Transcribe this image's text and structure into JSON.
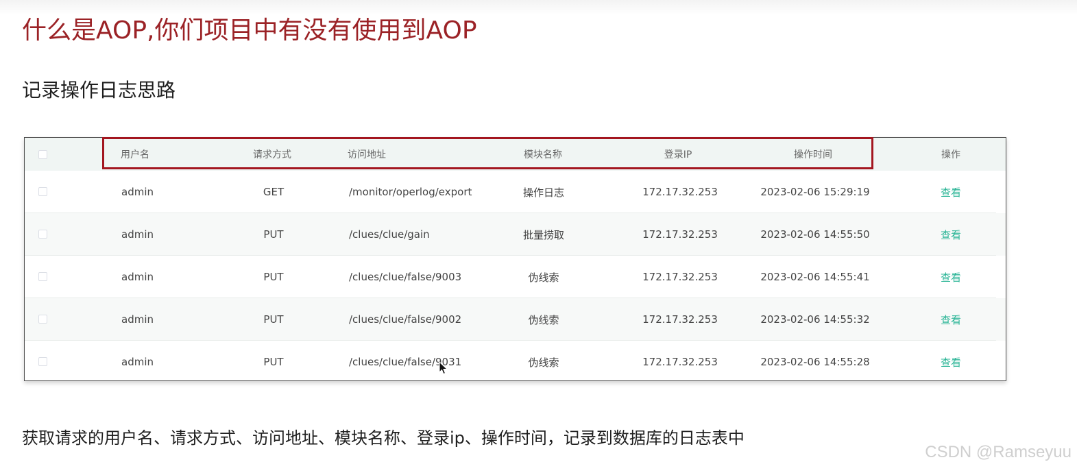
{
  "page": {
    "title": "什么是AOP,你们项目中有没有使用到AOP",
    "section_heading": "记录操作日志思路",
    "summary": "获取请求的用户名、请求方式、访问地址、模块名称、登录ip、操作时间，记录到数据库的日志表中",
    "watermark": "CSDN @Ramseyuu"
  },
  "table": {
    "headers": {
      "username": "用户名",
      "method": "请求方式",
      "url": "访问地址",
      "module": "模块名称",
      "ip": "登录IP",
      "time": "操作时间",
      "action": "操作"
    },
    "rows": [
      {
        "username": "admin",
        "method": "GET",
        "url": "/monitor/operlog/export",
        "module": "操作日志",
        "ip": "172.17.32.253",
        "time": "2023-02-06 15:29:19",
        "action": "查看"
      },
      {
        "username": "admin",
        "method": "PUT",
        "url": "/clues/clue/gain",
        "module": "批量捞取",
        "ip": "172.17.32.253",
        "time": "2023-02-06 14:55:50",
        "action": "查看"
      },
      {
        "username": "admin",
        "method": "PUT",
        "url": "/clues/clue/false/9003",
        "module": "伪线索",
        "ip": "172.17.32.253",
        "time": "2023-02-06 14:55:41",
        "action": "查看"
      },
      {
        "username": "admin",
        "method": "PUT",
        "url": "/clues/clue/false/9002",
        "module": "伪线索",
        "ip": "172.17.32.253",
        "time": "2023-02-06 14:55:32",
        "action": "查看"
      },
      {
        "username": "admin",
        "method": "PUT",
        "url": "/clues/clue/false/9031",
        "module": "伪线索",
        "ip": "172.17.32.253",
        "time": "2023-02-06 14:55:28",
        "action": "查看"
      }
    ]
  },
  "colors": {
    "title": "#9b2226",
    "highlight_border": "#a3161f",
    "link": "#2bb596",
    "header_background": "#f0f5f3"
  },
  "icons": {
    "cursor": "mouse-pointer-icon",
    "row_select": "checkbox"
  }
}
